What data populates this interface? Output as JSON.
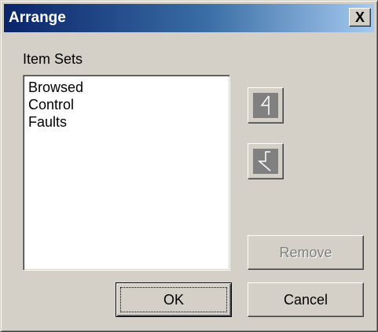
{
  "window": {
    "title": "Arrange",
    "close_symbol": "X"
  },
  "item_sets": {
    "label": "Item Sets",
    "items": [
      "Browsed",
      "Control",
      "Faults"
    ]
  },
  "buttons": {
    "move_up_icon": "move-up-icon",
    "move_down_icon": "move-down-icon",
    "remove_label": "Remove",
    "ok_label": "OK",
    "cancel_label": "Cancel"
  },
  "colors": {
    "dialog_face": "#d4d0c8",
    "title_gradient_start": "#0a246a",
    "title_gradient_end": "#a6caf0",
    "disabled_text": "#808080"
  }
}
